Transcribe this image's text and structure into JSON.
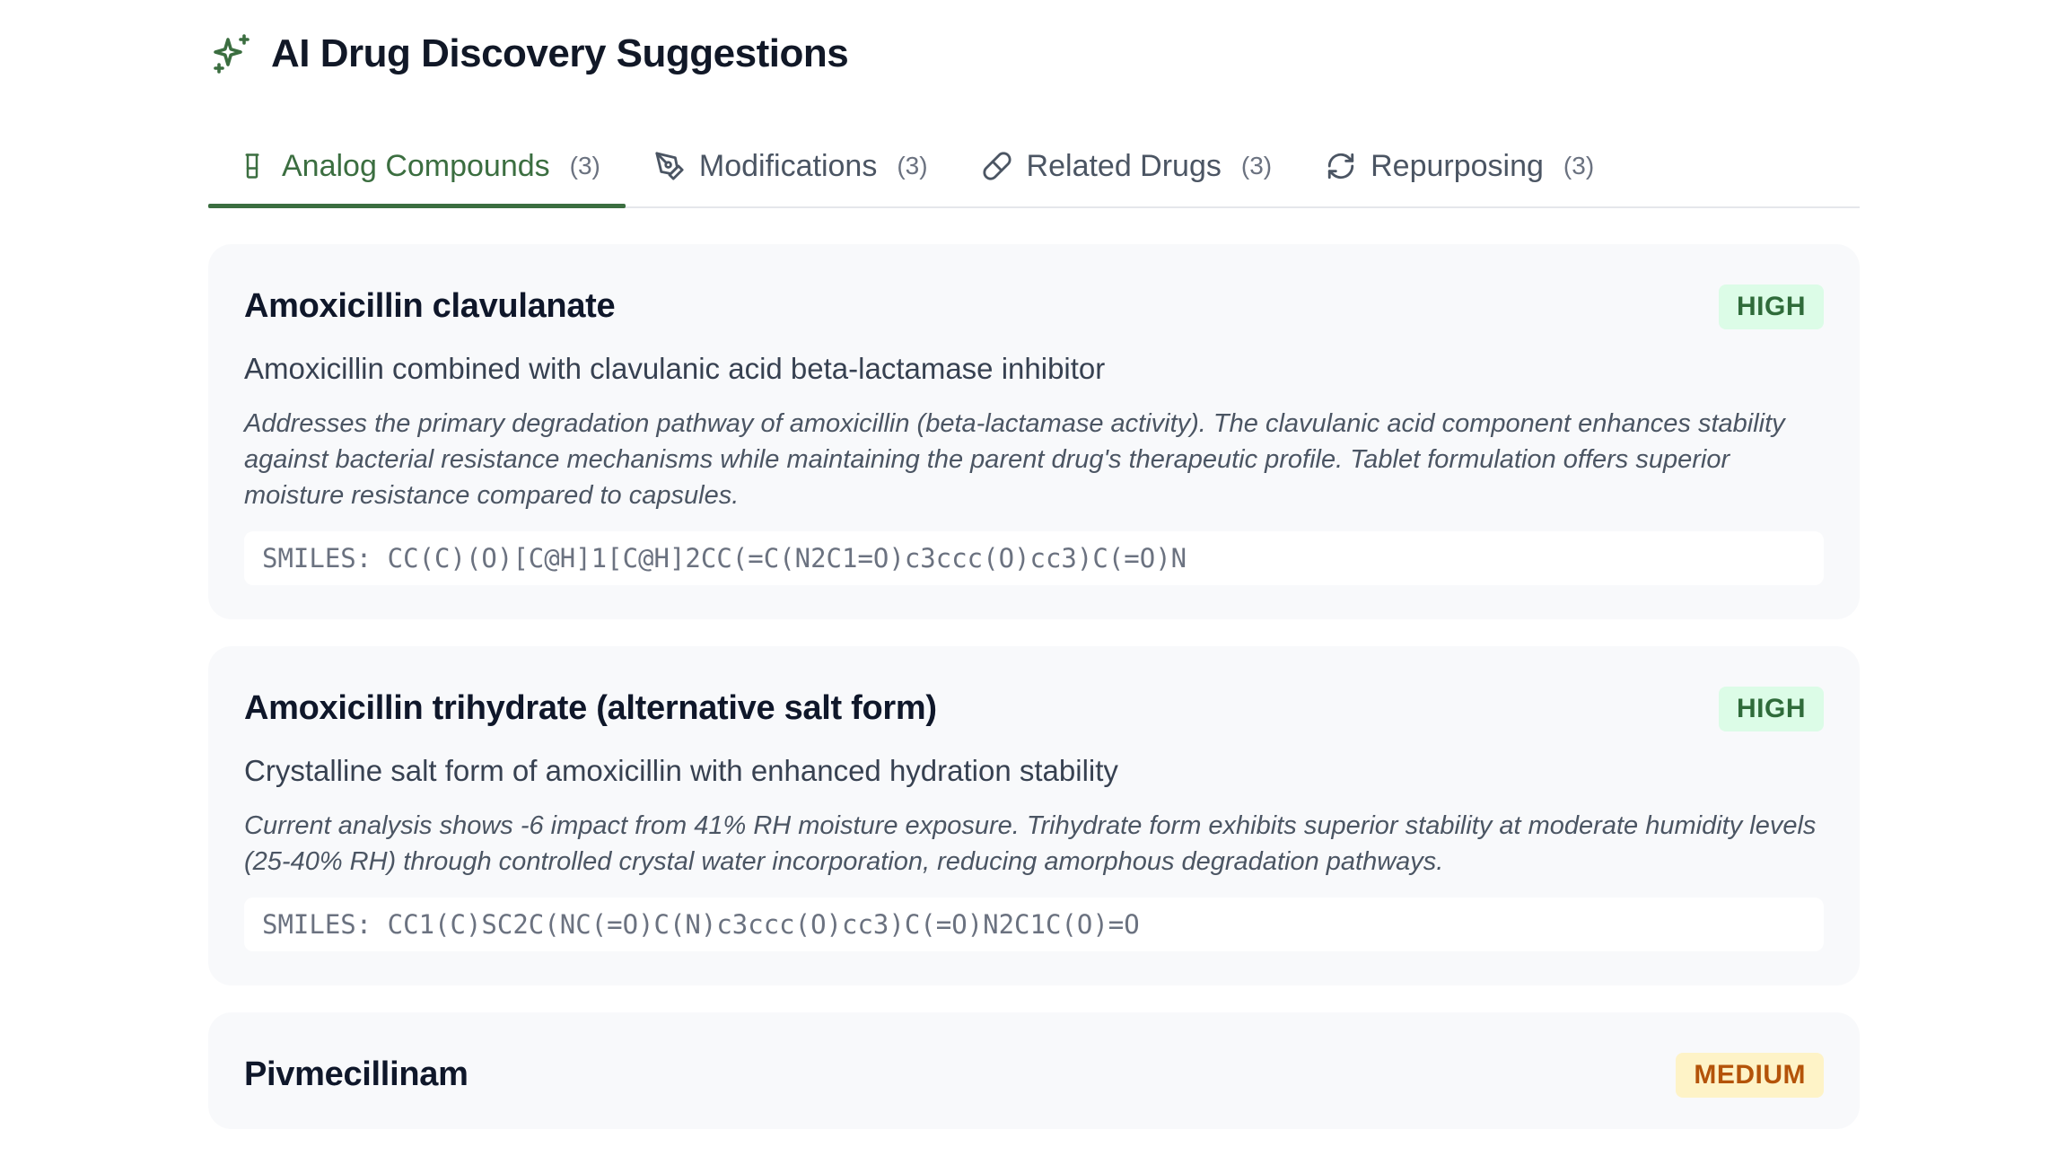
{
  "header": {
    "title": "AI Drug Discovery Suggestions",
    "icon": "sparkles-icon"
  },
  "colors": {
    "accent": "#3b6e40",
    "high_bg": "#dcfce7",
    "high_text": "#2f6b3a",
    "medium_bg": "#fef3c7",
    "medium_text": "#b45309"
  },
  "tabs": [
    {
      "label": "Analog Compounds",
      "count": "(3)",
      "icon": "flask-icon",
      "active": true
    },
    {
      "label": "Modifications",
      "count": "(3)",
      "icon": "pen-tool-icon",
      "active": false
    },
    {
      "label": "Related Drugs",
      "count": "(3)",
      "icon": "pill-icon",
      "active": false
    },
    {
      "label": "Repurposing",
      "count": "(3)",
      "icon": "refresh-icon",
      "active": false
    }
  ],
  "cards": [
    {
      "title": "Amoxicillin clavulanate",
      "badge": "HIGH",
      "subtitle": "Amoxicillin combined with clavulanic acid beta-lactamase inhibitor",
      "rationale": "Addresses the primary degradation pathway of amoxicillin (beta-lactamase activity). The clavulanic acid component enhances stability against bacterial resistance mechanisms while maintaining the parent drug's therapeutic profile. Tablet formulation offers superior moisture resistance compared to capsules.",
      "smiles": "SMILES: CC(C)(O)[C@H]1[C@H]2CC(=C(N2C1=O)c3ccc(O)cc3)C(=O)N"
    },
    {
      "title": "Amoxicillin trihydrate (alternative salt form)",
      "badge": "HIGH",
      "subtitle": "Crystalline salt form of amoxicillin with enhanced hydration stability",
      "rationale": "Current analysis shows -6 impact from 41% RH moisture exposure. Trihydrate form exhibits superior stability at moderate humidity levels (25-40% RH) through controlled crystal water incorporation, reducing amorphous degradation pathways.",
      "smiles": "SMILES: CC1(C)SC2C(NC(=O)C(N)c3ccc(O)cc3)C(=O)N2C1C(O)=O"
    },
    {
      "title": "Pivmecillinam",
      "badge": "MEDIUM"
    }
  ]
}
